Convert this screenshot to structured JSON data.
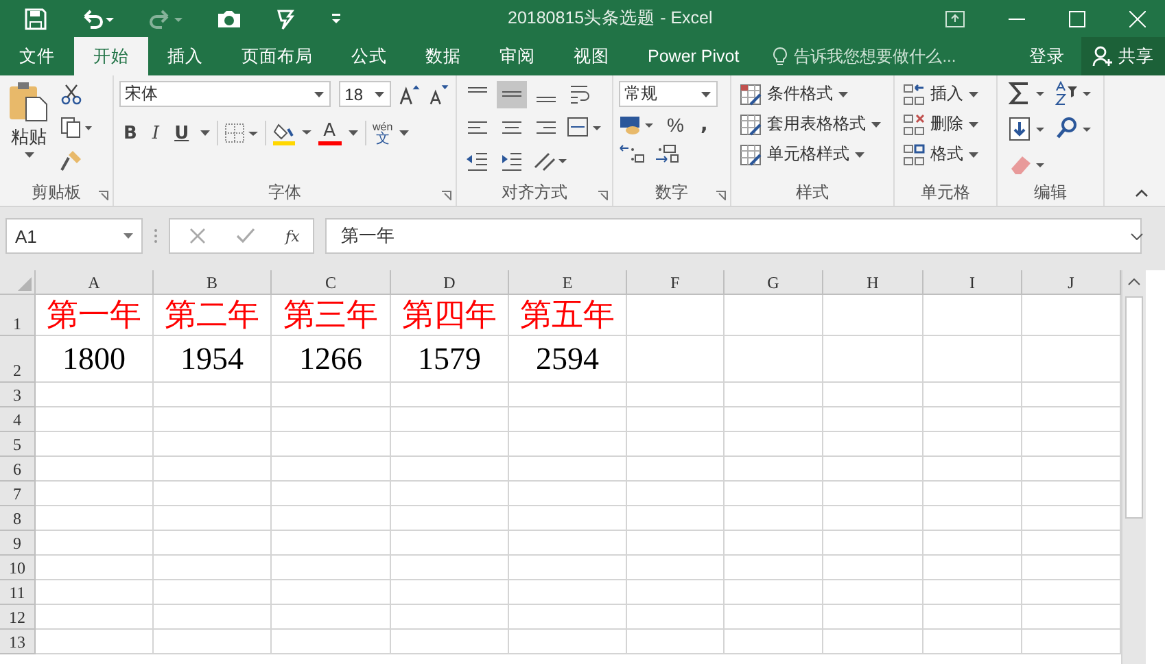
{
  "window": {
    "title": "20180815头条选题 - Excel"
  },
  "menu_tabs": [
    {
      "label": "文件",
      "selected": false
    },
    {
      "label": "开始",
      "selected": true
    },
    {
      "label": "插入",
      "selected": false
    },
    {
      "label": "页面布局",
      "selected": false
    },
    {
      "label": "公式",
      "selected": false
    },
    {
      "label": "数据",
      "selected": false
    },
    {
      "label": "审阅",
      "selected": false
    },
    {
      "label": "视图",
      "selected": false
    },
    {
      "label": "Power Pivot",
      "selected": false
    }
  ],
  "tell_me": {
    "placeholder": "告诉我您想要做什么..."
  },
  "account": {
    "login": "登录",
    "share": "共享"
  },
  "ribbon": {
    "clipboard": {
      "paste": "粘贴",
      "label": "剪贴板"
    },
    "font": {
      "font_name": "宋体",
      "font_size": "18",
      "bold": "B",
      "italic": "I",
      "underline": "U",
      "font_color": "A",
      "phonetic_top": "wén",
      "phonetic_bottom": "文",
      "label": "字体"
    },
    "alignment": {
      "vertical": [
        {
          "selected": false
        },
        {
          "selected": true
        },
        {
          "selected": false
        }
      ],
      "label": "对齐方式"
    },
    "number": {
      "format": "常规",
      "percent": "%",
      "comma": ",",
      "label": "数字"
    },
    "styles": {
      "items": [
        "条件格式",
        "套用表格格式",
        "单元格样式"
      ],
      "label": "样式"
    },
    "cells": {
      "items": [
        "插入",
        "删除",
        "格式"
      ],
      "label": "单元格"
    },
    "editing": {
      "label": "编辑"
    }
  },
  "formula_bar": {
    "name_box": "A1",
    "fx": "fx",
    "formula": "第一年"
  },
  "sheet": {
    "columns": [
      "A",
      "B",
      "C",
      "D",
      "E",
      "F",
      "G",
      "H",
      "I",
      "J"
    ],
    "rows": [
      {
        "header": "1",
        "color": "#ff0000",
        "cells": [
          "第一年",
          "第二年",
          "第三年",
          "第四年",
          "第五年"
        ]
      },
      {
        "header": "2",
        "color": "#000000",
        "cells": [
          "1800",
          "1954",
          "1266",
          "1579",
          "2594"
        ]
      },
      {
        "header": "3",
        "cells": []
      },
      {
        "header": "4",
        "cells": []
      },
      {
        "header": "5",
        "cells": []
      },
      {
        "header": "6",
        "cells": []
      },
      {
        "header": "7",
        "cells": []
      },
      {
        "header": "8",
        "cells": []
      },
      {
        "header": "9",
        "cells": []
      },
      {
        "header": "10",
        "cells": []
      },
      {
        "header": "11",
        "cells": []
      },
      {
        "header": "12",
        "cells": []
      },
      {
        "header": "13",
        "cells": []
      }
    ]
  }
}
